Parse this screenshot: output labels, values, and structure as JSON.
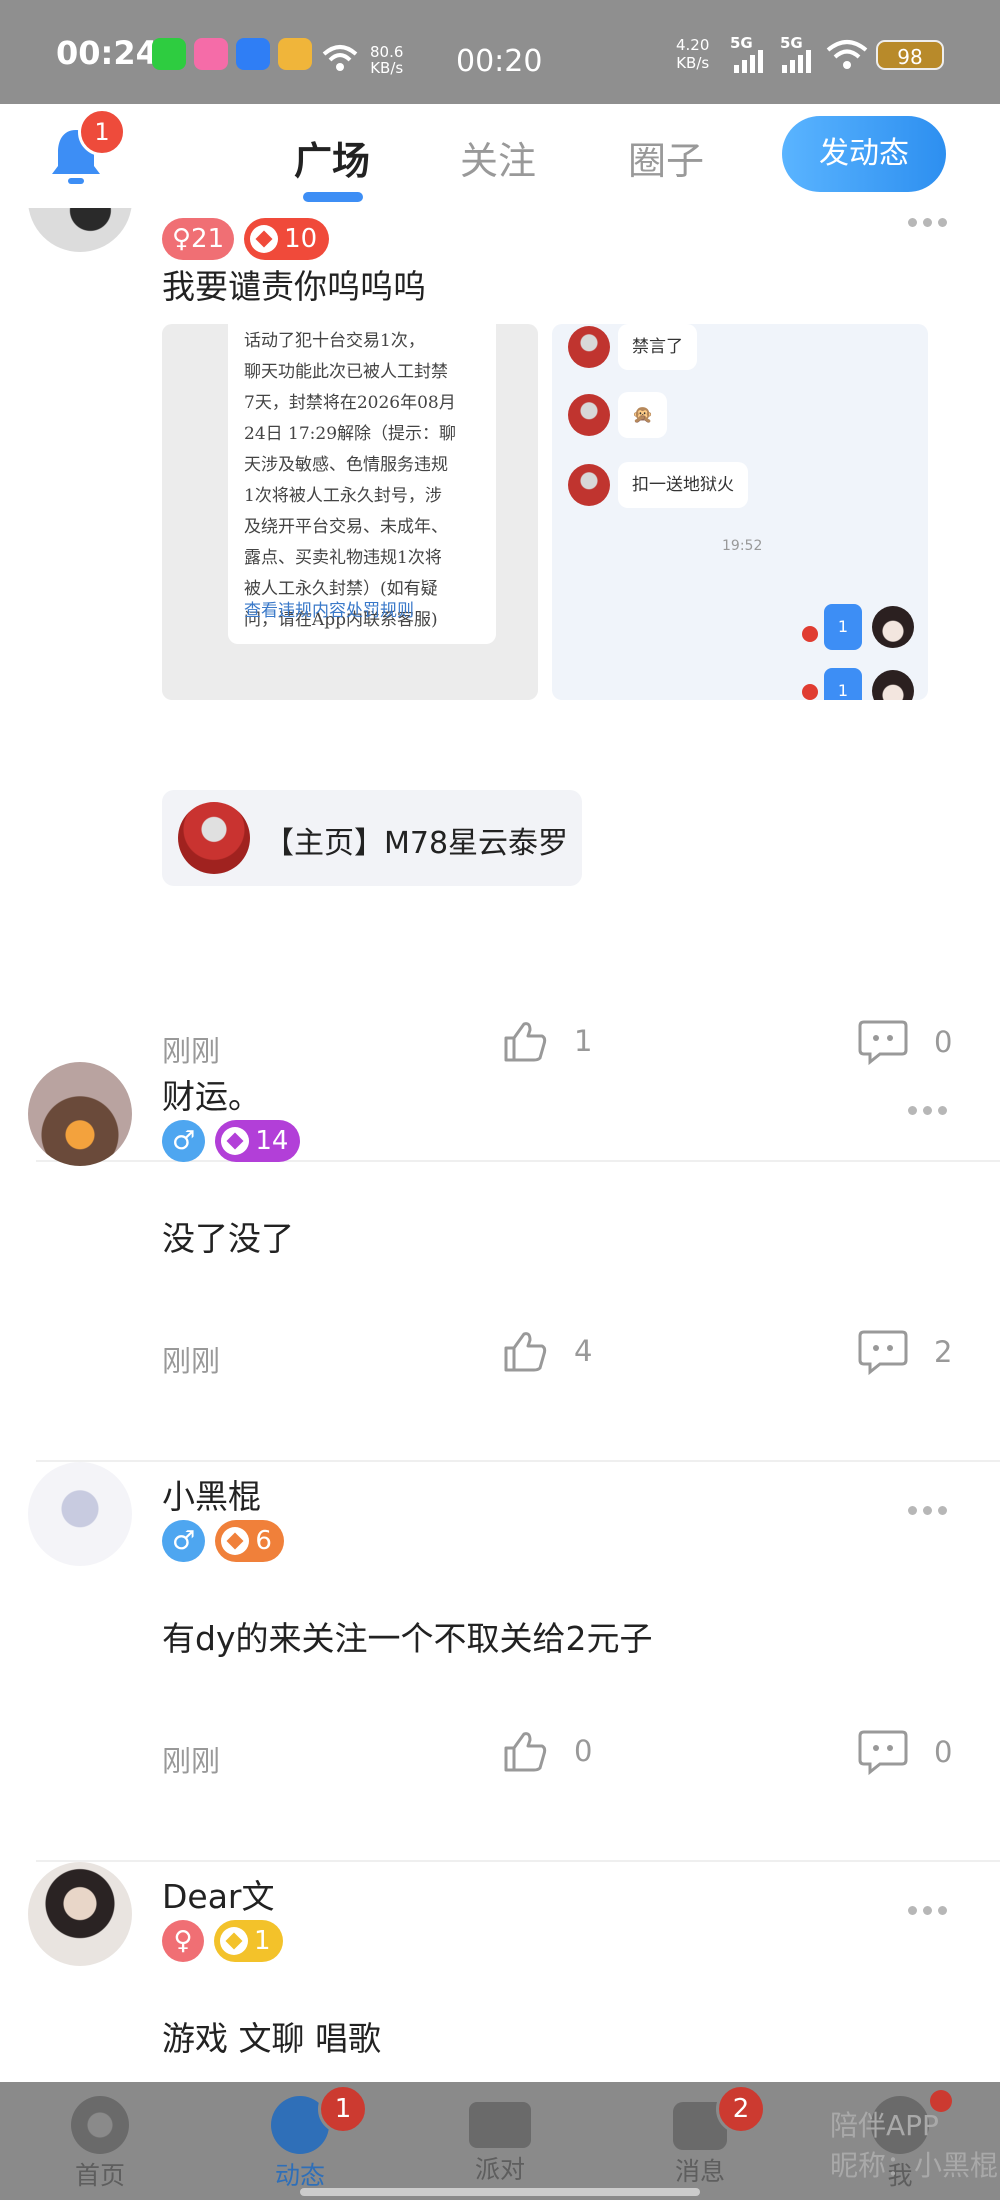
{
  "status_bar": {
    "time": "00:24",
    "net_speed_value": "80.6",
    "net_speed_unit": "KB/s",
    "center_time": "00:20",
    "kbs_value": "4.20",
    "kbs_unit": "KB/s",
    "sig1": "5G",
    "sig2": "5G",
    "battery": "98"
  },
  "top_nav": {
    "bell_badge": "1",
    "tabs": [
      "广场",
      "关注",
      "圈子"
    ],
    "active_tab": "广场",
    "post_button": "发动态"
  },
  "posts": [
    {
      "gender": "♀21",
      "level": "10",
      "content": "我要谴责你呜呜呜",
      "images": {
        "notice_lines": [
          "话动了犯十台交易1次，",
          "聊天功能此次已被人工封禁",
          "7天，封禁将在2026年08月",
          "24日 17:29解除（提示：聊",
          "天涉及敏感、色情服务违规",
          "1次将被人工永久封号，涉",
          "及绕开平台交易、未成年、",
          "露点、买卖礼物违规1次将",
          "被人工永久封禁）(如有疑",
          "问，请在App内联系客服)"
        ],
        "notice_link": "查看违规内容处罚规则",
        "chat": {
          "msg1": "禁言了",
          "msg2": "🙊",
          "msg3": "扣一送地狱火",
          "time": "19:52",
          "reply1": "1",
          "reply2": "1"
        }
      },
      "link_card": "【主页】M78星云泰罗",
      "time": "刚刚",
      "likes": "1",
      "comments": "0"
    },
    {
      "username": "财运。",
      "gender": "♂",
      "level": "14",
      "content": "没了没了",
      "time": "刚刚",
      "likes": "4",
      "comments": "2"
    },
    {
      "username": "小黑棍",
      "gender": "♂",
      "level": "6",
      "content": "有dy的来关注一个不取关给2元子",
      "time": "刚刚",
      "likes": "0",
      "comments": "0"
    },
    {
      "username": "Dear文",
      "gender": "♀",
      "level": "1",
      "content": "游戏 文聊 唱歌"
    }
  ],
  "bottom_nav": {
    "items": [
      "首页",
      "动态",
      "派对",
      "消息",
      "我"
    ],
    "badge_dynamic": "1",
    "badge_message": "2",
    "watermark_line1": "陪伴APP",
    "watermark_line2": "昵称：小黑棍"
  },
  "colors": {
    "accent": "#3d8ef5",
    "female": "#f06f74",
    "male": "#4ea6f0",
    "level_red": "#f04a3a",
    "level_purple": "#b23fd8",
    "level_orange": "#f0803a",
    "level_yellow": "#f3c22a"
  }
}
